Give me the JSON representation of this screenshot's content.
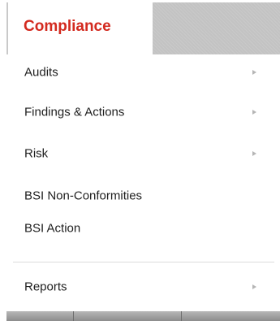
{
  "header": {
    "title": "Compliance"
  },
  "menu": {
    "items": [
      {
        "label": "Audits",
        "has_submenu": true
      },
      {
        "label": "Findings & Actions",
        "has_submenu": true
      },
      {
        "label": "Risk",
        "has_submenu": true
      },
      {
        "label": "BSI Non-Conformities",
        "has_submenu": false
      },
      {
        "label": "BSI Action",
        "has_submenu": false
      },
      {
        "label": "Reports",
        "has_submenu": true
      }
    ]
  },
  "colors": {
    "title": "#d32a1f",
    "header_fill": "#c3c3c3",
    "text": "#1e1e1e",
    "arrow": "#b5b5b5"
  },
  "icons": {
    "submenu_arrow": "caret-right-icon"
  }
}
